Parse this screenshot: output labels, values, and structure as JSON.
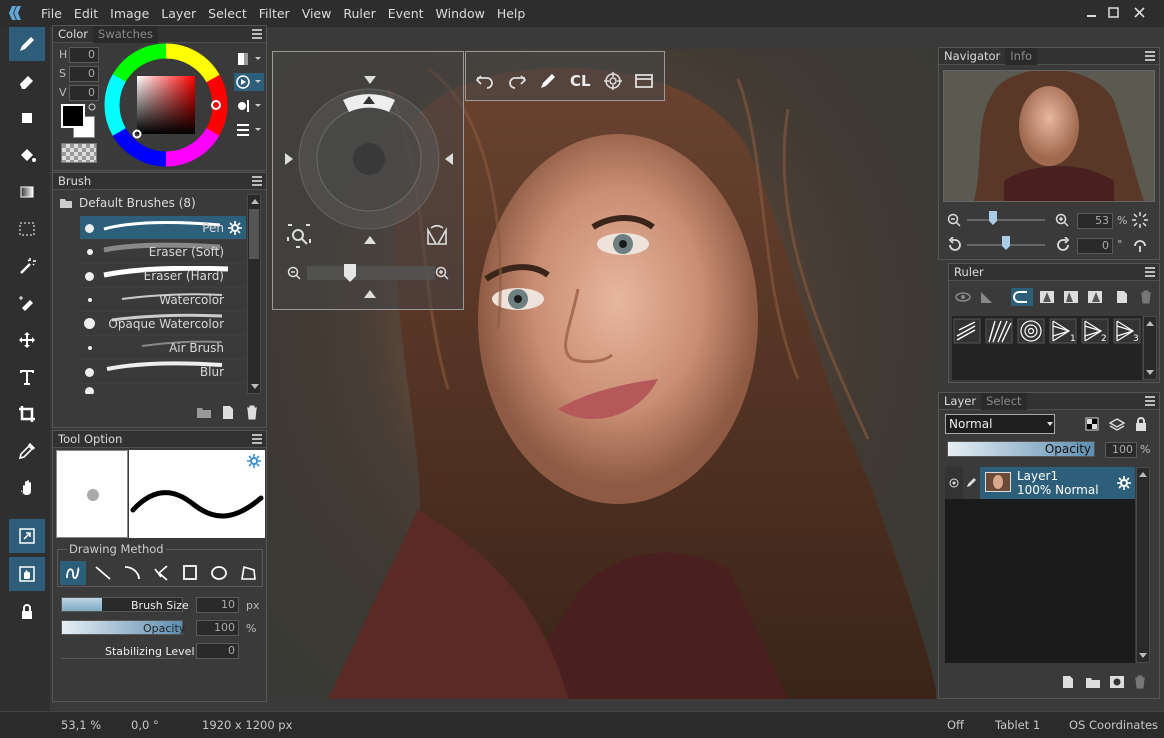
{
  "menubar": {
    "items": [
      "File",
      "Edit",
      "Image",
      "Layer",
      "Select",
      "Filter",
      "View",
      "Ruler",
      "Event",
      "Window",
      "Help"
    ]
  },
  "colors": {
    "accent": "#2e5f7a",
    "panel_bg": "#3a3a3a",
    "dark_bg": "#2d2d2d",
    "text": "#dcdcdc"
  },
  "toolbar": {
    "tools": [
      "pen-icon",
      "eraser-icon",
      "rectangle-icon",
      "fill-icon",
      "gradient-icon",
      "selection-icon",
      "magic-wand-icon",
      "selection-pen-icon",
      "move-icon",
      "text-icon",
      "crop-icon",
      "eyedropper-icon",
      "hand-icon",
      "transform-icon",
      "hand-grab-icon",
      "lock-icon"
    ]
  },
  "color_panel": {
    "tabs": [
      "Color",
      "Swatches"
    ],
    "h_label": "H",
    "s_label": "S",
    "v_label": "V",
    "h_value": "0",
    "s_value": "0",
    "v_value": "0"
  },
  "brush_panel": {
    "title": "Brush",
    "folder": "Default Brushes (8)",
    "items": [
      "Pen",
      "Eraser (Soft)",
      "Eraser (Hard)",
      "Watercolor",
      "Opaque Watercolor",
      "Air Brush",
      "Blur"
    ]
  },
  "tool_option": {
    "title": "Tool Option",
    "drawing_method": "Drawing Method",
    "brush_size_label": "Brush Size",
    "brush_size_value": "10",
    "brush_size_unit": "px",
    "opacity_label": "Opacity",
    "opacity_value": "100",
    "opacity_unit": "%",
    "stabilizing_label": "Stabilizing Level",
    "stabilizing_value": "0",
    "brush_size_fill": 0.33,
    "opacity_fill": 1.0
  },
  "quickbar": {
    "cl_label": "CL"
  },
  "navigator": {
    "tabs": [
      "Navigator",
      "Info"
    ],
    "zoom_value": "53",
    "zoom_unit": "%",
    "rotate_value": "0",
    "rotate_unit": "°"
  },
  "ruler_panel": {
    "title": "Ruler"
  },
  "layer_panel": {
    "tabs": [
      "Layer",
      "Select"
    ],
    "blend_mode": "Normal",
    "opacity_label": "Opacity",
    "opacity_value": "100",
    "opacity_unit": "%",
    "layer_name": "Layer1",
    "layer_info": "100% Normal"
  },
  "statusbar": {
    "zoom": "53,1 %",
    "angle": "0,0 °",
    "size": "1920 x 1200 px",
    "off": "Off",
    "tablet": "Tablet 1",
    "coords": "OS Coordinates"
  }
}
